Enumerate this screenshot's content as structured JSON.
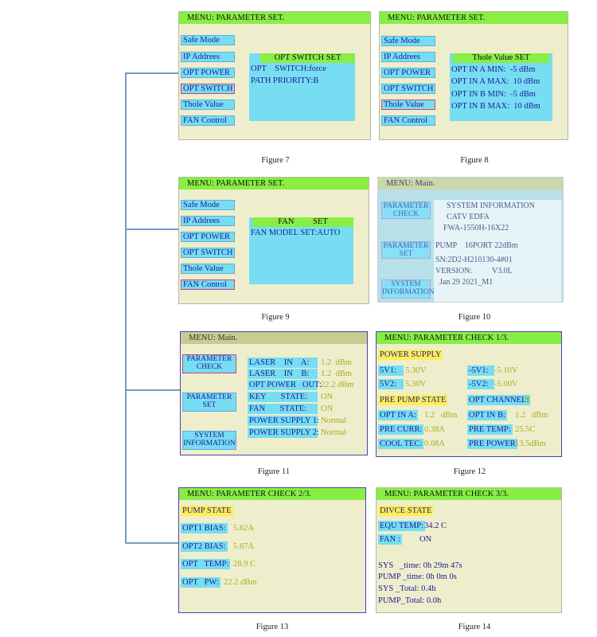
{
  "menu_items": [
    "Safe Mode",
    "IP Addrees",
    "OPT POWER",
    "OPT SWITCH",
    "Thole Value",
    "FAN Control"
  ],
  "fig7": {
    "header": "MENU: PARAMETER SET.",
    "panel_title": "OPT SWITCH SET",
    "line1": "OPT    SWITCH:force",
    "line2": "PATH PRIORITY:B",
    "caption": "Figure 7"
  },
  "fig8": {
    "header": "MENU: PARAMETER SET.",
    "panel_title": "Thole Value SET",
    "lines": [
      "OPT IN A MIN:  -5 dBm",
      "OPT IN A MAX:  10 dBm",
      "OPT IN B MIN:  -5 dBm",
      "OPT IN B MAX:  10 dBm"
    ],
    "caption": "Figure 8"
  },
  "fig9": {
    "header": "MENU: PARAMETER SET.",
    "panel_title": "FAN         SET",
    "line1": "FAN MODEL SET:AUTO",
    "caption": "Figure 9"
  },
  "fig10": {
    "header": "MENU: Main.",
    "btn1": "PARAMETER CHECK",
    "btn2": "PARAMETER SET",
    "btn3": "SYSTEM INFORMATION",
    "lines": [
      "SYSTEM INFORMATION",
      "CATV EDFA",
      "FWA-1550H-16X22",
      "PUMP    16PORT 22dBm",
      "SN:2D2-H210130-4#01",
      "VERSION:          V3.0L",
      "  Jan 29 2021_M1"
    ],
    "caption": "Figure 10"
  },
  "fig11": {
    "header": "MENU: Main.",
    "btn1": "PARAMETER CHECK",
    "btn2": "PARAMETER SET",
    "btn3": "SYSTEM INFORMATION",
    "rows": [
      {
        "label": "LASER    IN    A:",
        "value": "1.2  dBm"
      },
      {
        "label": "LASER    IN    B:",
        "value": "1.2  dBm"
      },
      {
        "label": "OPT POWER   OUT:",
        "value": "22.2 dBm"
      },
      {
        "label": "KEY       STATE:",
        "value": "ON"
      },
      {
        "label": "FAN       STATE:",
        "value": "ON"
      },
      {
        "label": "POWER SUPPLY 1:",
        "value": "Normal"
      },
      {
        "label": "POWER SUPPLY 2:",
        "value": "Normal"
      }
    ],
    "caption": "Figure 11"
  },
  "fig12": {
    "header": "MENU: PARAMETER CHECK 1/3.",
    "power_supply": "POWER SUPPLY",
    "v1_label": "5V1:",
    "v1_value": "5.30V",
    "nv1_label": "-5V1:",
    "nv1_value": "-5.10V",
    "v2_label": "5V2:",
    "v2_value": "5.30V",
    "nv2_label": "-5V2:",
    "nv2_value": "-5.00V",
    "pre_pump": "PRE PUMP STATE",
    "opt_channel_label": "OPT CHANNEL:",
    "opt_channel_value": "B",
    "opt_in_a_label": "OPT IN A:",
    "opt_in_a_value": "1.2   dBm",
    "opt_in_b_label": "OPT IN B:",
    "opt_in_b_value": "1.2   dBm",
    "pre_curr_label": "PRE CURR:",
    "pre_curr_value": "0.38A",
    "pre_temp_label": "PRE TEMP:",
    "pre_temp_value": "25.5C",
    "cool_tec_label": "COOL TEC:",
    "cool_tec_value": "0.08A",
    "pre_power_label": "PRE POWER",
    "pre_power_value": "13.5dBm",
    "caption": "Figure 12"
  },
  "fig13": {
    "header": "MENU: PARAMETER CHECK 2/3.",
    "pump_state": "PUMP STATE",
    "bias1_label": "OPT1 BIAS:",
    "bias1_value": "5.62A",
    "bias2_label": "OPT2 BIAS:",
    "bias2_value": "5.67A",
    "temp_label": "OPT   TEMP:",
    "temp_value": "28.9 C",
    "pw_label": "OPT   PW:",
    "pw_value": "22.2 dBm",
    "caption": "Figure 13"
  },
  "fig14": {
    "header": "MENU: PARAMETER CHECK 3/3.",
    "divce_state": "DIVCE STATE",
    "equ_temp_label": "EQU TEMP:",
    "equ_temp_value": "34.2 C",
    "fan_label": "FAN :",
    "fan_value": "ON",
    "lines": [
      "SYS   _time: 0h 29m 47s",
      "PUMP _time: 0h 0m 0s",
      "SYS _Total: 0.4h",
      "PUMP_Total: 0.0h"
    ],
    "caption": "Figure 14"
  },
  "colors": {
    "connector": "#4a7ab0",
    "header_green": "#88ee44",
    "cyan": "#77ddf2",
    "yellow": "#ffee55",
    "select_border": "#d04080"
  }
}
